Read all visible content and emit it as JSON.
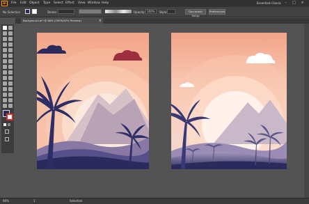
{
  "app": {
    "logo": "Ai"
  },
  "menu": [
    "File",
    "Edit",
    "Object",
    "Type",
    "Select",
    "Effect",
    "View",
    "Window",
    "Help"
  ],
  "workspace": "Essentials Classic",
  "window_controls": [
    "–",
    "□",
    "×"
  ],
  "control_bar": {
    "selection": "No Selection",
    "stroke_label": "Stroke:",
    "opacity_label": "Opacity:",
    "opacity_value": "100%",
    "style_label": "Style:",
    "document_setup": "Document Setup",
    "preferences": "Preferences"
  },
  "document_tab": {
    "title": "Background.ai* @ 66% (CMYK/GPU Preview)",
    "close": "×"
  },
  "status_bar": {
    "zoom": "66%",
    "artboard_number": "1",
    "tool_name": "Selection"
  },
  "colors": {
    "sky_top": "#f1a98e",
    "sky_mid": "#f7c6ad",
    "sun": "#fbe8dc",
    "mountain": "#b9a6b8",
    "dune_light": "#8a7aa4",
    "ground": "#2b2a5c",
    "palm": "#2e2d66",
    "cloud_left": "#2b2a5c",
    "cloud_right": "#9e2f3e",
    "cloud_white": "#ffffff"
  }
}
